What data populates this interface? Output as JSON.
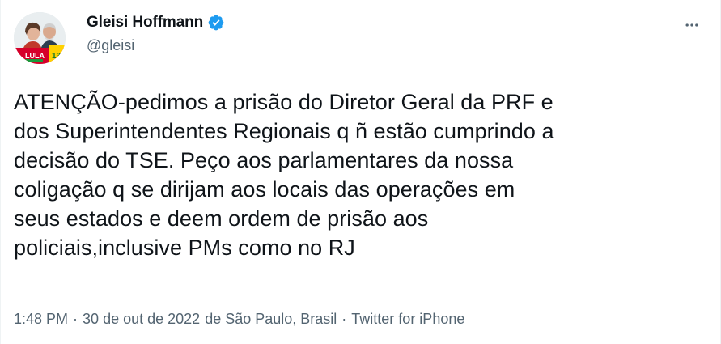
{
  "author": {
    "display_name": "Gleisi Hoffmann",
    "handle": "@gleisi",
    "verified": true,
    "avatar_badge_text": "LULA",
    "avatar_badge_number": "13"
  },
  "tweet": {
    "text": "ATENÇÃO-pedimos a prisão do Diretor Geral da PRF e\ndos Superintendentes Regionais q ñ estão cumprindo a\ndecisão do TSE. Peço aos parlamentares da nossa\ncoligação q se dirijam aos locais das operações em\nseus estados e deem ordem de prisão aos\npoliciais,inclusive PMs como no RJ"
  },
  "meta": {
    "time": "1:48 PM",
    "separator": "·",
    "date": "30 de out de 2022",
    "location": "de São Paulo, Brasil",
    "source": "Twitter for iPhone"
  },
  "icons": {
    "verified": "verified-badge-icon",
    "more": "more-horizontal-icon"
  },
  "colors": {
    "text_primary": "#0f1419",
    "text_secondary": "#536471",
    "verified_blue": "#1d9bf0"
  }
}
